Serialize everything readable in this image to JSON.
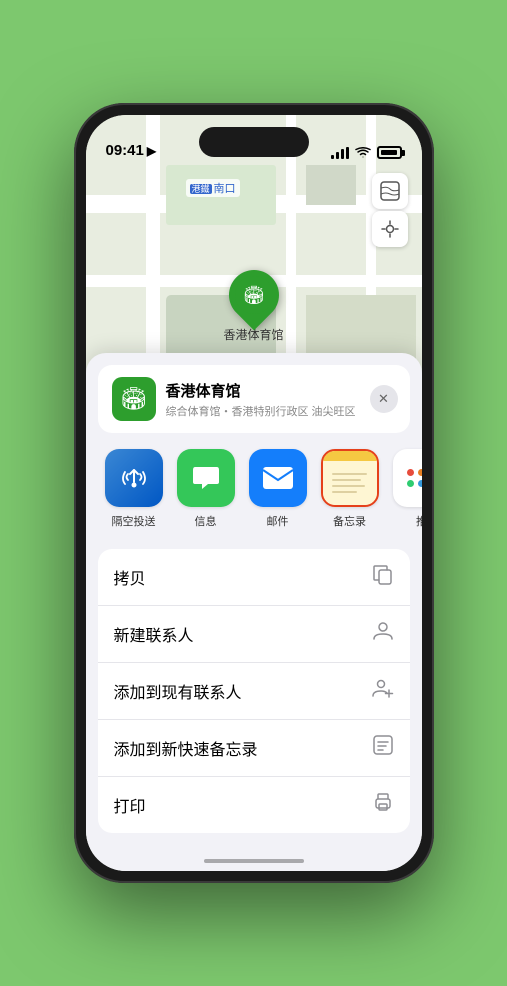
{
  "status_bar": {
    "time": "09:41",
    "location_arrow": "▶"
  },
  "map": {
    "station_label": "南口",
    "marker_label": "香港体育馆",
    "marker_emoji": "🏟"
  },
  "venue": {
    "name": "香港体育馆",
    "subtitle": "综合体育馆・香港特别行政区 油尖旺区",
    "close_label": "×"
  },
  "share_items": [
    {
      "id": "airdrop",
      "label": "隔空投送"
    },
    {
      "id": "messages",
      "label": "信息"
    },
    {
      "id": "mail",
      "label": "邮件"
    },
    {
      "id": "notes",
      "label": "备忘录"
    },
    {
      "id": "more",
      "label": "推"
    }
  ],
  "actions": [
    {
      "label": "拷贝",
      "icon": "copy"
    },
    {
      "label": "新建联系人",
      "icon": "person"
    },
    {
      "label": "添加到现有联系人",
      "icon": "person-add"
    },
    {
      "label": "添加到新快速备忘录",
      "icon": "note"
    },
    {
      "label": "打印",
      "icon": "print"
    }
  ]
}
